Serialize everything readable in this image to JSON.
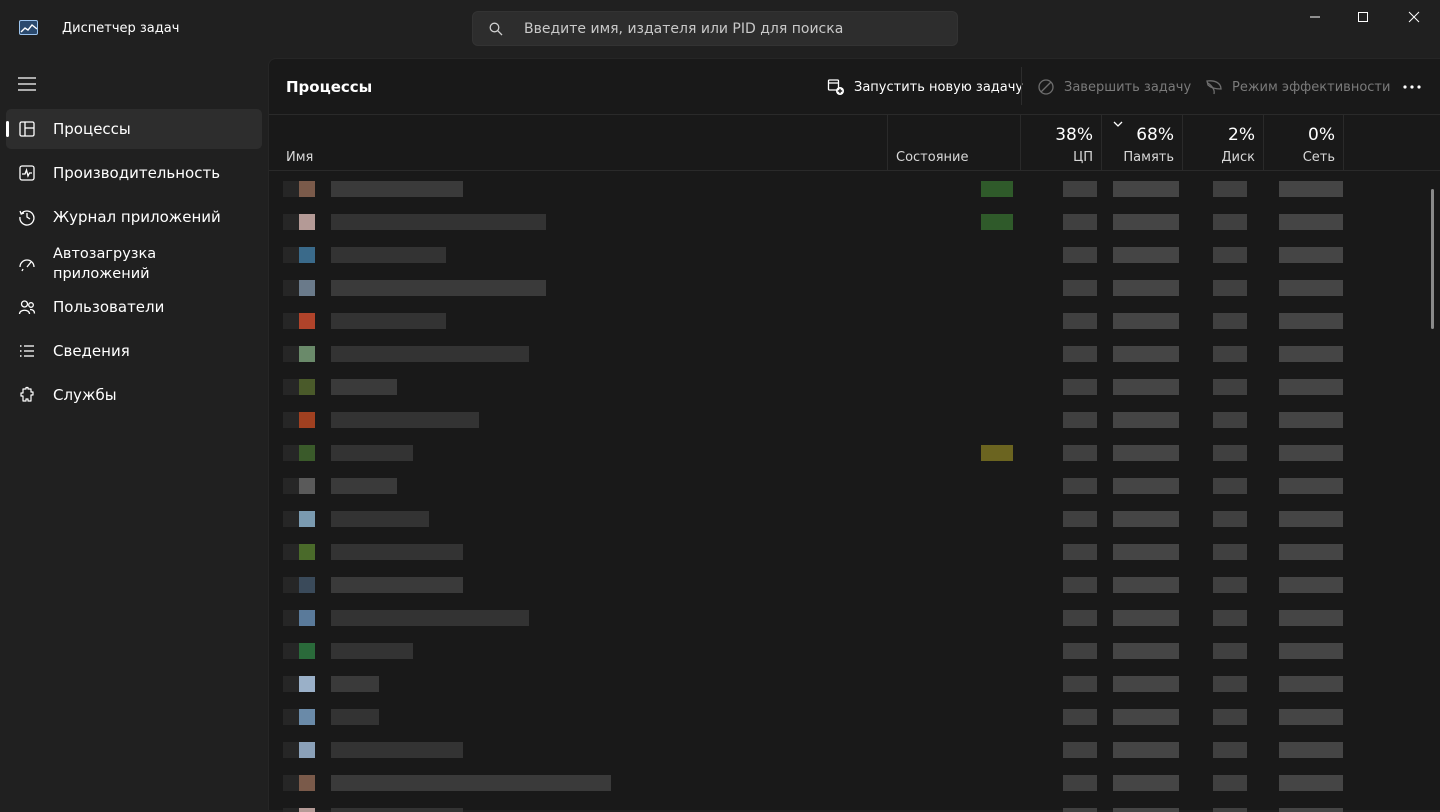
{
  "app": {
    "title": "Диспетчер задач"
  },
  "search": {
    "placeholder": "Введите имя, издателя или PID для поиска"
  },
  "sidebar": {
    "items": [
      {
        "label": "Процессы",
        "icon": "processes-icon",
        "selected": true
      },
      {
        "label": "Производительность",
        "icon": "performance-icon",
        "selected": false
      },
      {
        "label": "Журнал приложений",
        "icon": "app-history-icon",
        "selected": false
      },
      {
        "label": "Автозагрузка\nприложений",
        "icon": "startup-apps-icon",
        "selected": false
      },
      {
        "label": "Пользователи",
        "icon": "users-icon",
        "selected": false
      },
      {
        "label": "Сведения",
        "icon": "details-icon",
        "selected": false
      },
      {
        "label": "Службы",
        "icon": "services-icon",
        "selected": false
      }
    ]
  },
  "main": {
    "title": "Процессы",
    "toolbar": {
      "run_new_task": "Запустить новую задачу",
      "end_task": "Завершить задачу",
      "efficiency_mode": "Режим эффективности"
    }
  },
  "columns": {
    "name": "Имя",
    "status": "Состояние",
    "cpu": {
      "pct": "38%",
      "label": "ЦП"
    },
    "memory": {
      "pct": "68%",
      "label": "Память"
    },
    "disk": {
      "pct": "2%",
      "label": "Диск"
    },
    "network": {
      "pct": "0%",
      "label": "Сеть"
    }
  },
  "colors": {
    "accent_green": "#2f5a2a",
    "accent_yellow": "#6b6420"
  }
}
